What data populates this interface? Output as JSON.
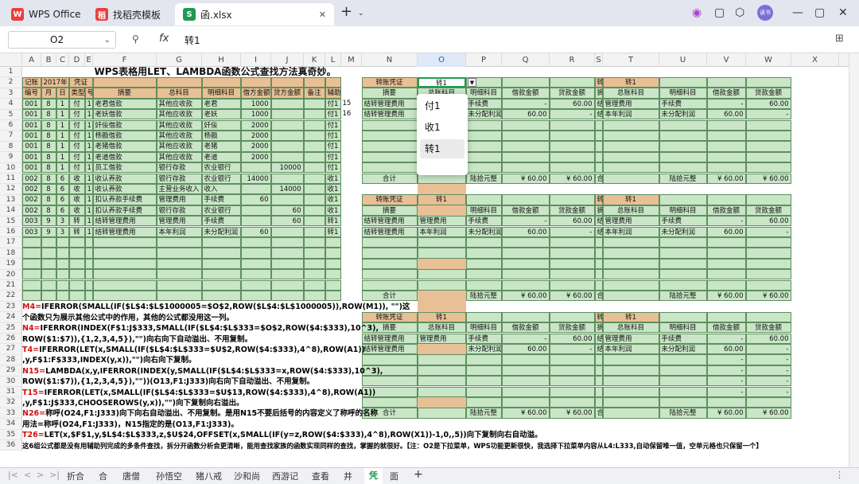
{
  "tabs": {
    "wps": "WPS Office",
    "template": "找稻壳模板",
    "file": "函.xlsx",
    "new": "+"
  },
  "formula": {
    "cell": "O2",
    "fx": "fx",
    "content": "转1"
  },
  "columns": [
    "A",
    "B",
    "C",
    "D",
    "E",
    "F",
    "G",
    "H",
    "I",
    "J",
    "K",
    "L",
    "M",
    "N",
    "O",
    "P",
    "Q",
    "R",
    "S",
    "T",
    "U",
    "V",
    "W",
    "X"
  ],
  "title": "WPS表格用LET、LAMBDA函数公式查找方法真奇妙。",
  "left_header": {
    "r2": [
      "记账",
      "2017年",
      "",
      "凭证"
    ],
    "r3": [
      "编号",
      "月",
      "日",
      "类型",
      "号",
      "摘要",
      "总科目",
      "明细科目",
      "借方金额",
      "贷方金额",
      "备注",
      "辅助"
    ]
  },
  "ledger": [
    [
      "001",
      "8",
      "1",
      "付",
      "1",
      "老君借款",
      "其他应收款",
      "老君",
      "1000",
      "",
      "",
      "付1"
    ],
    [
      "001",
      "8",
      "1",
      "付",
      "1",
      "老妖借款",
      "其他应收款",
      "老妖",
      "1000",
      "",
      "",
      "付1"
    ],
    [
      "001",
      "8",
      "1",
      "付",
      "1",
      "奸佞借款",
      "其他应收款",
      "奸佞",
      "2000",
      "",
      "",
      "付1"
    ],
    [
      "001",
      "8",
      "1",
      "付",
      "1",
      "杨戬借款",
      "其他应收款",
      "杨戬",
      "2000",
      "",
      "",
      "付1"
    ],
    [
      "001",
      "8",
      "1",
      "付",
      "1",
      "老猪借款",
      "其他应收款",
      "老猪",
      "2000",
      "",
      "",
      "付1"
    ],
    [
      "001",
      "8",
      "1",
      "付",
      "1",
      "老道借款",
      "其他应收款",
      "老道",
      "2000",
      "",
      "",
      "付1"
    ],
    [
      "001",
      "8",
      "1",
      "付",
      "1",
      "员工借款",
      "银行存款",
      "农业银行",
      "",
      "10000",
      "",
      "付1"
    ],
    [
      "002",
      "8",
      "6",
      "收",
      "1",
      "收认养款",
      "银行存款",
      "农业银行",
      "14000",
      "",
      "",
      "收1"
    ],
    [
      "002",
      "8",
      "6",
      "收",
      "1",
      "收认养款",
      "主营业务收入",
      "收入",
      "",
      "14000",
      "",
      "收1"
    ],
    [
      "002",
      "8",
      "6",
      "收",
      "1",
      "扣认养款手续费",
      "管理费用",
      "手续费",
      "60",
      "",
      "",
      "收1"
    ],
    [
      "002",
      "8",
      "6",
      "收",
      "1",
      "扣认养款手续费",
      "银行存款",
      "农业银行",
      "",
      "60",
      "",
      "收1"
    ],
    [
      "003",
      "9",
      "3",
      "转",
      "1",
      "结转管理费用",
      "管理费用",
      "手续费",
      "",
      "60",
      "",
      "转1"
    ],
    [
      "003",
      "9",
      "3",
      "转",
      "1",
      "结转管理费用",
      "本年利润",
      "未分配利润",
      "60",
      "",
      "",
      "转1"
    ]
  ],
  "m_values": {
    "r4": "15",
    "r5": "16"
  },
  "voucher": {
    "title": "转账凭证",
    "id": "转1",
    "headers": [
      "摘要",
      "总账科目",
      "明细科目",
      "借款金额",
      "贷款金额"
    ],
    "row1": [
      "结转管理费用",
      "管理费用",
      "手续费",
      "-",
      "60.00"
    ],
    "row2": [
      "结转管理费用",
      "本年利润",
      "未分配利润",
      "60.00",
      "-"
    ],
    "total": "合计",
    "upper": "陆拾元整",
    "sym": "¥",
    "amt": "60.00"
  },
  "dropdown": [
    "付1",
    "收1",
    "转1"
  ],
  "notes": [
    {
      "k": "M4=",
      "t": "IFERROR(SMALL(IF($L$4:$L$1000005=$O$2,ROW($L$4:$L$1000005)),ROW(M1)), \"\")这"
    },
    {
      "k": "",
      "t": "个函数只为展示其他公式中的作用，其他的公式都没用这一列。"
    },
    {
      "k": "N4=",
      "t": "IFERROR(INDEX(F$1:J$333,SMALL(IF($L$4:$L$333=$O$2,ROW($4:$333),10^3),"
    },
    {
      "k": "",
      "t": "ROW($1:$7)),{1,2,3,4,5}),\"\")向右向下自动溢出、不用复制。"
    },
    {
      "k": "T4=",
      "t": "IFERROR(LET(x,SMALL(IF($L$4:$L$333=$U$2,ROW($4:$333),4^8),ROW(A1))"
    },
    {
      "k": "",
      "t": ",y,F$1:F$333,INDEX(y,x)),\"\")向右向下复制。"
    },
    {
      "k": "N15=",
      "t": "LAMBDA(x,y,IFERROR(INDEX(y,SMALL(IF($L$4:$L$333=x,ROW($4:$333),10^3),"
    },
    {
      "k": "",
      "t": "ROW($1:$7)),{1,2,3,4,5}),\"\"))(O13,F1:J333)向右向下自动溢出、不用复制。"
    },
    {
      "k": "T15=",
      "t": "IFERROR(LET(x,SMALL(IF($L$4:$L$333=$U$13,ROW($4:$333),4^8),ROW(A1))"
    },
    {
      "k": "",
      "t": ",y,F$1:J$333,CHOOSEROWS(y,x)),\"\")向下复制向右溢出。"
    },
    {
      "k": "N26=",
      "t": "称呼(O24,F1:J333)向下向右自动溢出、不用复制。是用N15不要后括号的内容定义了称呼的名称"
    },
    {
      "k": "",
      "t": "用法=称呼(O24,F1:J333)，N15指定的是(O13,F1:J333)。"
    },
    {
      "k": "T26=",
      "t": "LET(x,$F$1,y,$L$4:$L$333,z,$U$24,OFFSET(x,SMALL(IF(y=z,ROW($4:$333),4^8),ROW(X1))-1,0,,5))向下复制向右自动溢。"
    },
    {
      "k": "",
      "t": "这6组公式都是没有用辅助列完成的多条件查找，拆分开函数分析会更清晰，能用查找家族的函数实现同样的查找，掌握的就很好。【注：O2是下拉菜单，WPS功能更新很快，我选择下拉菜单内容从L4:L333,自动保留唯一值，空单元格也只保留一个】"
    }
  ],
  "sheet_tabs": [
    "折合",
    "合",
    "唐僧",
    "孙悟空",
    "猪八戒",
    "沙和尚",
    "西游记",
    "查看",
    "井",
    "凭",
    "面"
  ],
  "active_sheet": "凭"
}
